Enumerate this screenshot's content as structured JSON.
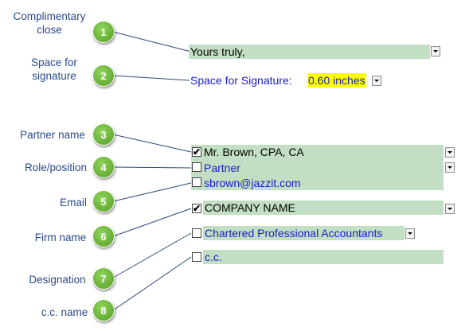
{
  "labels": {
    "l1": "Complimentary\nclose",
    "l2": "Space for\nsignature",
    "l3": "Partner name",
    "l4": "Role/position",
    "l5": "Email",
    "l6": "Firm name",
    "l7": "Designation",
    "l8": "c.c. name"
  },
  "badges": [
    "1",
    "2",
    "3",
    "4",
    "5",
    "6",
    "7",
    "8"
  ],
  "fields": {
    "complimentary_close": "Yours truly,",
    "signature_label": "Space for Signature:",
    "signature_value": "0.60 inches",
    "partner_name": "Mr. Brown, CPA, CA",
    "partner_checked": "✔",
    "role": "Partner",
    "email": "sbrown@jazzit.com",
    "firm_name": "COMPANY NAME",
    "firm_checked": "✔",
    "designation": "Chartered Professional Accountants",
    "cc": "c.c."
  },
  "colors": {
    "badge_green": "#6cb33a",
    "field_bg": "#c3dfc3",
    "label_blue": "#2b4a8a",
    "value_blue": "#1a1acc",
    "highlight": "#ffff00"
  }
}
